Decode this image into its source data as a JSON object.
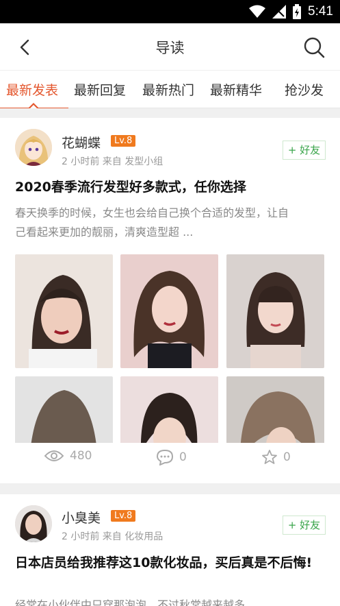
{
  "status_bar": {
    "time": "5:41"
  },
  "nav": {
    "title": "导读"
  },
  "tabs": [
    {
      "label": "最新发表"
    },
    {
      "label": "最新回复"
    },
    {
      "label": "最新热门"
    },
    {
      "label": "最新精华"
    },
    {
      "label": "抢沙发"
    }
  ],
  "posts": [
    {
      "username": "花蝴蝶",
      "level": "Lv.8",
      "meta": "2 小时前 来自  发型小组",
      "friend_label": "+ 好友",
      "title": "2020春季流行发型好多款式，任你选择",
      "excerpt": "春天换季的时候，女生也会给自己换个合适的发型，让自己看起来更加的靓丽，清爽造型超 ...",
      "views": "480",
      "comments": "0",
      "likes": "0"
    },
    {
      "username": "小臭美",
      "level": "Lv.8",
      "meta": "2 小时前 来自  化妆用品",
      "friend_label": "+ 好友",
      "title": "日本店员给我推荐这10款化妆品，买后真是不后悔!",
      "excerpt": "经常在小伙伴中只穿那泡泡，不过秋常越来越多"
    }
  ],
  "colors": {
    "accent": "#e4572e",
    "level": "#f07a1e",
    "friend": "#3aa54b"
  }
}
